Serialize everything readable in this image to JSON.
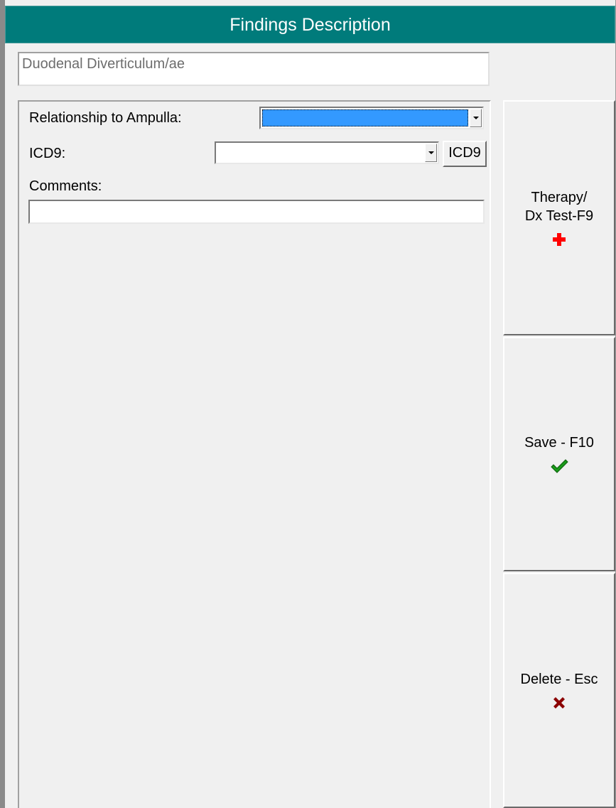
{
  "window": {
    "title": "Findings Description"
  },
  "finding": {
    "description": "Duodenal Diverticulum/ae"
  },
  "form": {
    "relationship_label": "Relationship to Ampulla:",
    "relationship_value": "",
    "icd9_label": "ICD9:",
    "icd9_value": "",
    "icd9_button": "ICD9",
    "comments_label": "Comments:",
    "comments_value": ""
  },
  "buttons": {
    "therapy": {
      "label": "Therapy/\nDx Test-F9",
      "icon": "red-cross-icon",
      "color": "#ff0000"
    },
    "save": {
      "label": "Save - F10",
      "icon": "checkmark-icon",
      "color": "#1a9a1a"
    },
    "delete": {
      "label": "Delete - Esc",
      "icon": "x-icon",
      "color": "#8b0000"
    }
  },
  "colors": {
    "title_bar": "#007b7b",
    "selection": "#3399ff"
  }
}
